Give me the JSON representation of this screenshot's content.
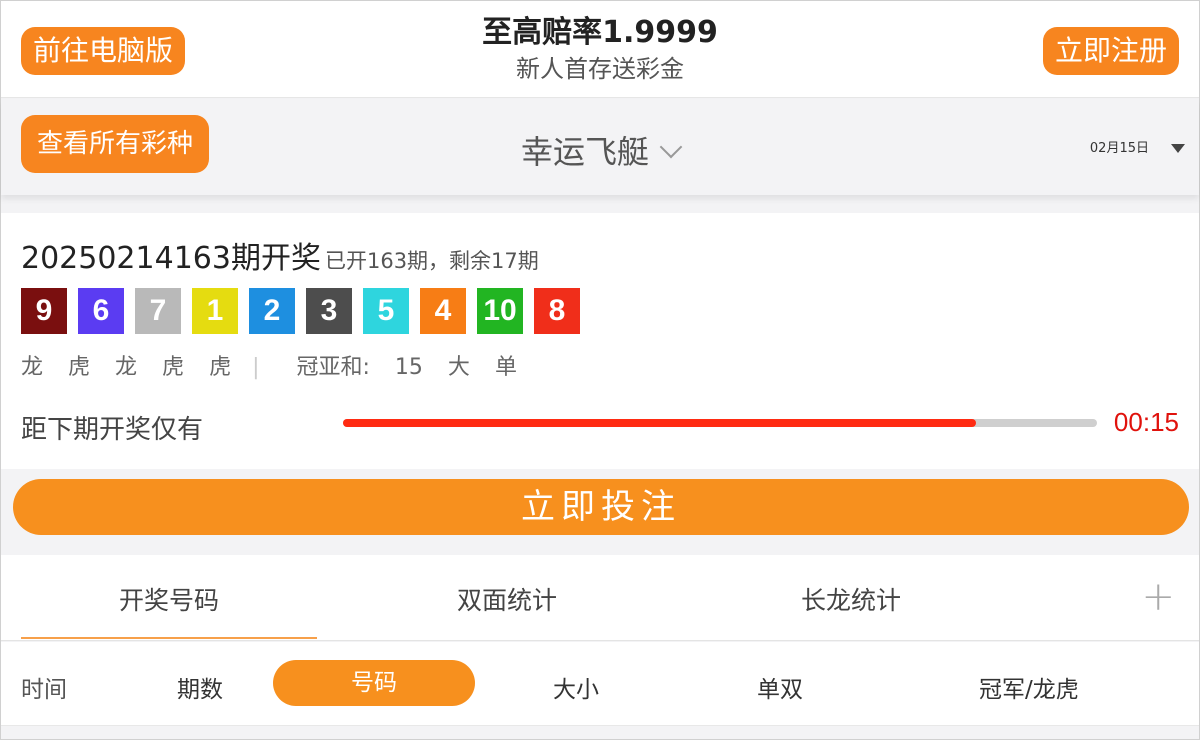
{
  "header": {
    "desktop_button": "前往电脑版",
    "register_button": "立即注册",
    "promo_title": "至高赔率1.9999",
    "promo_subtitle": "新人首存送彩金"
  },
  "lottery_bar": {
    "all_lotteries_button": "查看所有彩种",
    "lottery_name": "幸运飞艇",
    "date": "02月15日"
  },
  "draw": {
    "issue_text": "20250214163期开奖",
    "progress_text": "已开163期，剩余17期",
    "balls": [
      {
        "num": "9",
        "color": "#7a0f0f"
      },
      {
        "num": "6",
        "color": "#5b3cf2"
      },
      {
        "num": "7",
        "color": "#b9b9b9"
      },
      {
        "num": "1",
        "color": "#e5dc10"
      },
      {
        "num": "2",
        "color": "#1e8fe0"
      },
      {
        "num": "3",
        "color": "#4d4d4d"
      },
      {
        "num": "5",
        "color": "#2ed5de"
      },
      {
        "num": "4",
        "color": "#f77d15"
      },
      {
        "num": "10",
        "color": "#22b522"
      },
      {
        "num": "8",
        "color": "#f02e1a"
      }
    ],
    "dragon_tiger": [
      "龙",
      "虎",
      "龙",
      "虎",
      "虎"
    ],
    "sum_label": "冠亚和:",
    "sum_value": "15",
    "sum_size": "大",
    "sum_parity": "单",
    "countdown_label": "距下期开奖仅有",
    "countdown_time": "00:15",
    "countdown_progress": 0.84,
    "progress_color": "#ff2b12"
  },
  "bet_button": "立即投注",
  "tabs": [
    "开奖号码",
    "双面统计",
    "长龙统计"
  ],
  "subtabs": {
    "time": "时间",
    "issue": "期数",
    "number": "号码",
    "size": "大小",
    "parity": "单双",
    "champion": "冠军/龙虎"
  },
  "accent_color": "#f7851f"
}
